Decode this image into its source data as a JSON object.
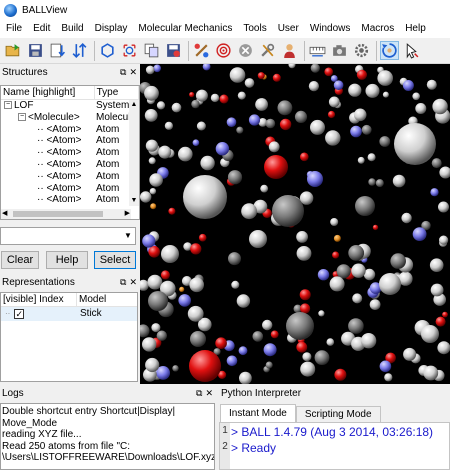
{
  "window": {
    "title": "BALLView"
  },
  "menu": [
    "File",
    "Edit",
    "Build",
    "Display",
    "Molecular Mechanics",
    "Tools",
    "User",
    "Windows",
    "Macros",
    "Help"
  ],
  "structures": {
    "title": "Structures",
    "columns": [
      "Name [highlight]",
      "Type"
    ],
    "rows": [
      {
        "name": "LOF",
        "type": "System"
      },
      {
        "name": "<Molecule>",
        "type": "Molecule"
      },
      {
        "name": "<Atom>",
        "type": "Atom"
      },
      {
        "name": "<Atom>",
        "type": "Atom"
      },
      {
        "name": "<Atom>",
        "type": "Atom"
      },
      {
        "name": "<Atom>",
        "type": "Atom"
      },
      {
        "name": "<Atom>",
        "type": "Atom"
      },
      {
        "name": "<Atom>",
        "type": "Atom"
      },
      {
        "name": "<Atom>",
        "type": "Atom"
      }
    ],
    "buttons": {
      "clear": "Clear",
      "help": "Help",
      "select": "Select"
    }
  },
  "representations": {
    "title": "Representations",
    "columns": [
      "[visible] Index",
      "Model"
    ],
    "rows": [
      {
        "visible": "✓",
        "model": "Stick"
      }
    ]
  },
  "logs": {
    "title": "Logs",
    "lines": [
      "Double shortcut entry Shortcut|Display|",
      "Move_Mode",
      "reading XYZ file...",
      "Read 250 atoms from file \"C:",
      "\\Users\\LISTOFFREEWARE\\Downloads\\LOF.xyz\""
    ]
  },
  "python": {
    "title": "Python Interpreter",
    "tabs": [
      "Instant Mode",
      "Scripting Mode"
    ],
    "lines": [
      {
        "num": "1",
        "text": "> BALL 1.4.79 (Aug  3 2014, 03:26:18)"
      },
      {
        "num": "2",
        "text": "> Ready"
      }
    ]
  },
  "colors": {
    "viewer_bg": "#000000",
    "carbon": "#e6e6e6",
    "oxygen": "#e01010",
    "nitrogen": "#7a7ae8",
    "hydrogen": "#ffffff"
  }
}
